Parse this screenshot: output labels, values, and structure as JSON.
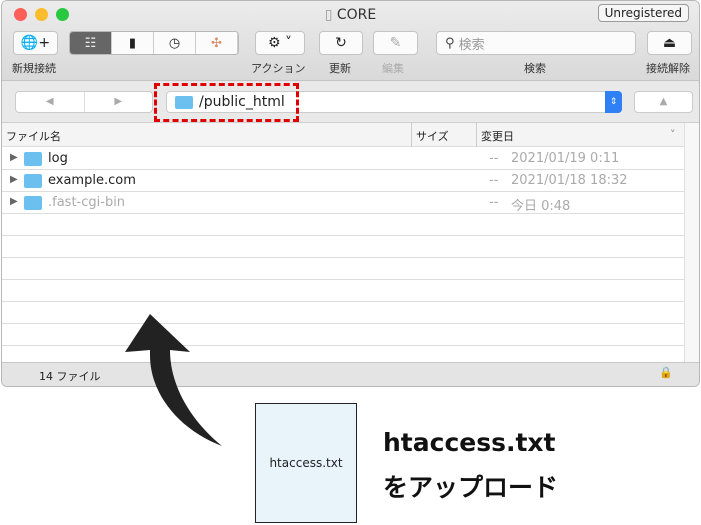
{
  "window": {
    "title": "CORE",
    "unregistered": "Unregistered"
  },
  "toolbar": {
    "new_connection": "新規接続",
    "action": "アクション",
    "refresh": "更新",
    "edit": "編集",
    "search_placeholder": "検索",
    "search_label": "検索",
    "disconnect": "接続解除"
  },
  "path": {
    "value": "/public_html"
  },
  "columns": {
    "name": "ファイル名",
    "size": "サイズ",
    "modified": "変更日"
  },
  "files": [
    {
      "name": "log",
      "size": "--",
      "modified": "2021/01/19 0:11",
      "dimmed": false
    },
    {
      "name": "example.com",
      "size": "--",
      "modified": "2021/01/18 18:32",
      "dimmed": false
    },
    {
      "name": ".fast-cgi-bin",
      "size": "--",
      "modified": "今日 0:48",
      "dimmed": true
    }
  ],
  "status": {
    "count": "14 ファイル"
  },
  "annotation": {
    "file_label": "htaccess.txt",
    "caption_line1": "htaccess.txt",
    "caption_line2": "をアップロード",
    "highlight_color": "#e00000"
  }
}
